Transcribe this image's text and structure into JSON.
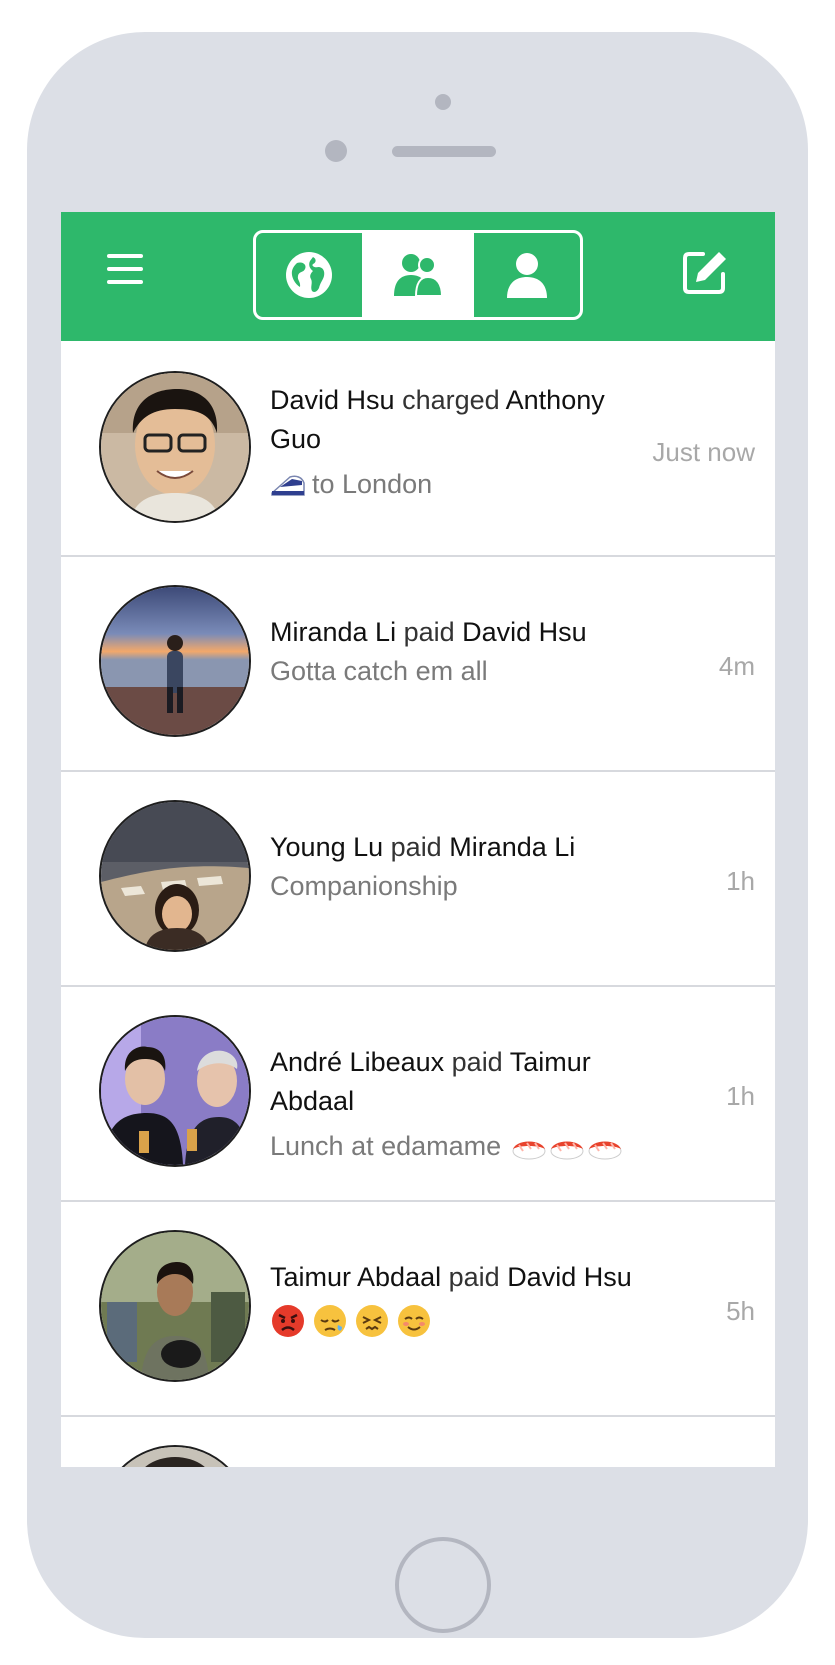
{
  "app": {
    "accent": "#2eb86b",
    "name": "venmo-style-feed"
  },
  "nav": {
    "menu_icon": "hamburger-icon",
    "tabs": [
      {
        "icon": "globe-icon",
        "active": false
      },
      {
        "icon": "friends-icon",
        "active": true
      },
      {
        "icon": "person-icon",
        "active": false
      }
    ],
    "compose_icon": "compose-icon"
  },
  "feed": [
    {
      "actor": "David Hsu",
      "verb": "charged",
      "target": "Anthony Guo",
      "note_emoji": "train-emoji",
      "note": "to London",
      "time": "Just now"
    },
    {
      "actor": "Miranda Li",
      "verb": "paid",
      "target": "David Hsu",
      "note": "Gotta catch em all",
      "time": "4m"
    },
    {
      "actor": "Young Lu",
      "verb": "paid",
      "target": "Miranda Li",
      "note": "Companionship",
      "time": "1h"
    },
    {
      "actor": "André Libeaux",
      "verb": "paid",
      "target": "Taimur Abdaal",
      "note": "Lunch at edamame",
      "note_emojis": [
        "sushi-emoji",
        "sushi-emoji",
        "sushi-emoji"
      ],
      "time": "1h"
    },
    {
      "actor": "Taimur Abdaal",
      "verb": "paid",
      "target": "David Hsu",
      "note": "",
      "note_emojis": [
        "angry-face-emoji",
        "sleepy-face-emoji",
        "persevering-face-emoji",
        "smiling-face-emoji"
      ],
      "time": "5h"
    }
  ]
}
